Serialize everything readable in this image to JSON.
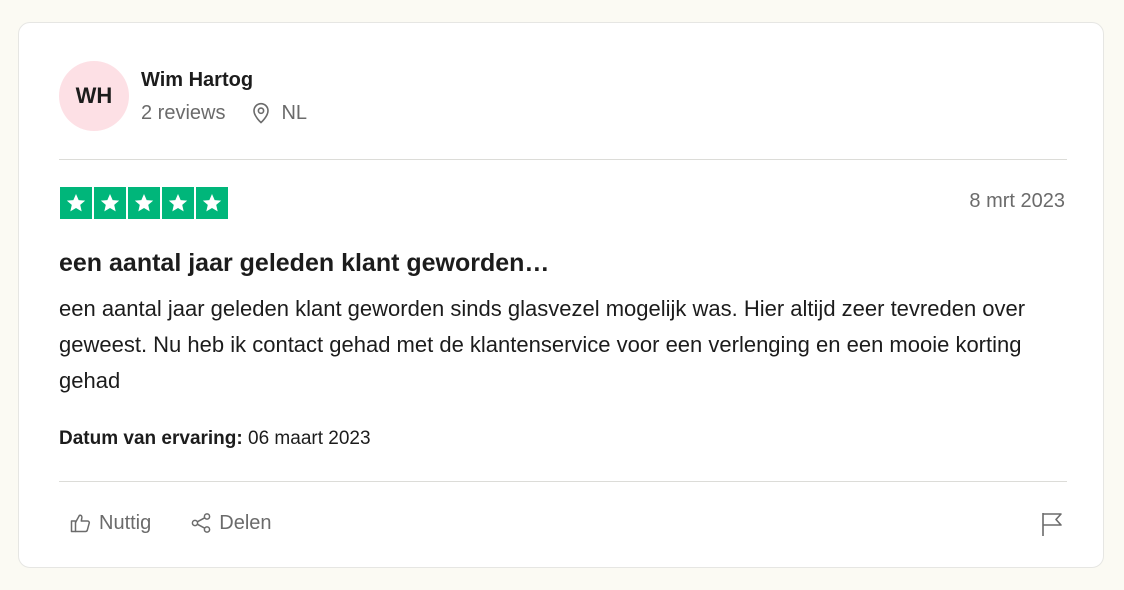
{
  "consumer": {
    "initials": "WH",
    "name": "Wim Hartog",
    "reviews": "2 reviews",
    "country": "NL",
    "avatar_color": "#fde0e5"
  },
  "review": {
    "rating": 5,
    "star_color": "#00b67a",
    "date": "8 mrt 2023",
    "title": "een aantal jaar geleden klant geworden…",
    "body": "een aantal jaar geleden klant geworden sinds glasvezel mogelijk was. Hier altijd zeer tevreden over geweest. Nu heb ik contact gehad met de klantenservice voor een verlenging en een mooie korting gehad",
    "experience_label": "Datum van ervaring:",
    "experience_date": "06 maart 2023"
  },
  "actions": {
    "useful_label": "Nuttig",
    "share_label": "Delen",
    "useful_icon": "thumbs-up-icon",
    "share_icon": "share-icon",
    "report_icon": "flag-icon"
  }
}
